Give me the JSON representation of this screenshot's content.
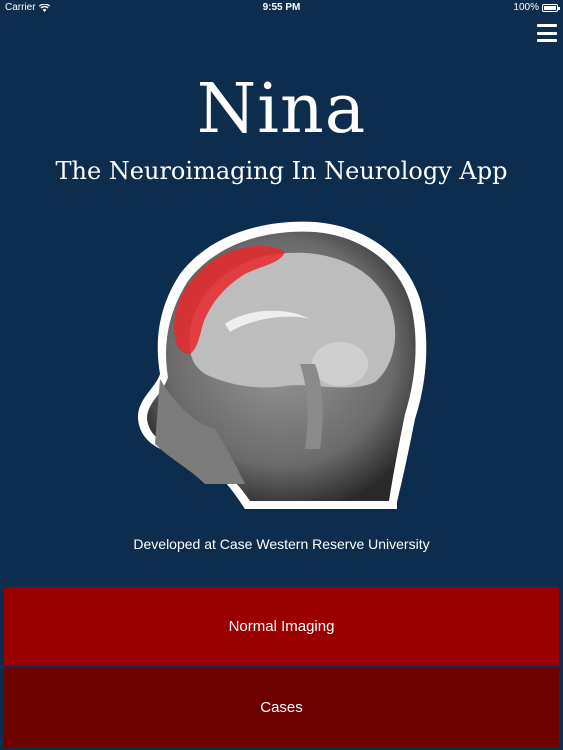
{
  "status_bar": {
    "carrier": "Carrier",
    "time": "9:55 PM",
    "battery": "100%"
  },
  "header": {
    "title": "Nina",
    "subtitle": "The Neuroimaging In Neurology App"
  },
  "footer_text": {
    "credit": "Developed at Case Western Reserve University"
  },
  "buttons": {
    "normal_imaging": "Normal Imaging",
    "cases": "Cases"
  },
  "colors": {
    "background": "#0d2d4f",
    "primary_button": "#9b0000",
    "secondary_button": "#6e0000",
    "highlight": "#e8282d"
  },
  "icons": {
    "menu": "hamburger-menu-icon",
    "wifi": "wifi-icon",
    "battery": "battery-icon"
  }
}
